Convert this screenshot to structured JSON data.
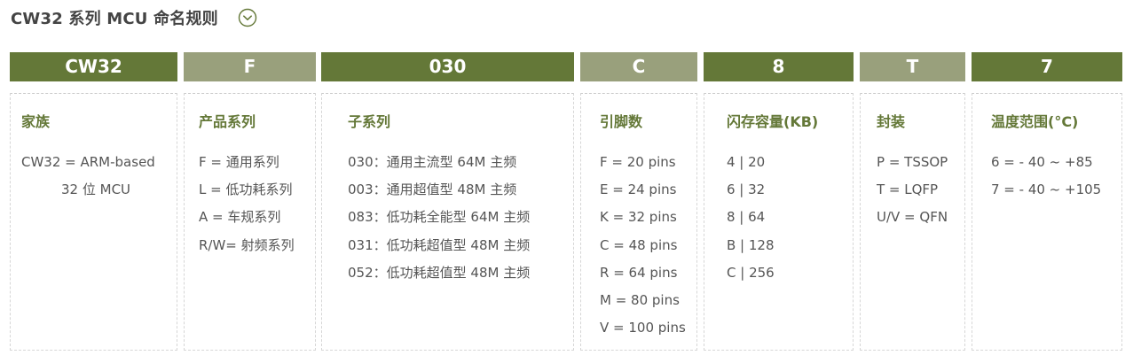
{
  "heading": {
    "title": "CW32 系列 MCU 命名规则",
    "toggle_icon": "chevron-down-circle-icon"
  },
  "colors": {
    "dark_bar": "#647838",
    "light_bar": "#99a07c",
    "label": "#647838"
  },
  "columns": [
    {
      "code": "CW32",
      "label": "家族",
      "items": [
        "CW32 = ARM-based",
        "32 位 MCU"
      ]
    },
    {
      "code": "F",
      "label": "产品系列",
      "items": [
        "F = 通用系列",
        "L = 低功耗系列",
        "A = 车规系列",
        "R/W= 射频系列"
      ]
    },
    {
      "code": "030",
      "label": "子系列",
      "items": [
        "030：通用主流型 64M 主频",
        "003：通用超值型 48M 主频",
        "083：低功耗全能型 64M 主频",
        "031：低功耗超值型 48M 主频",
        "052：低功耗超值型 48M 主频"
      ]
    },
    {
      "code": "C",
      "label": "引脚数",
      "items": [
        "F = 20 pins",
        "E = 24 pins",
        "K = 32 pins",
        "C = 48 pins",
        "R = 64 pins",
        "M = 80 pins",
        "V = 100 pins"
      ]
    },
    {
      "code": "8",
      "label": "闪存容量(KB)",
      "items": [
        "4 | 20",
        "6 | 32",
        "8 | 64",
        "B | 128",
        "C | 256"
      ]
    },
    {
      "code": "T",
      "label": "封装",
      "items": [
        "P = TSSOP",
        "T = LQFP",
        "U/V = QFN"
      ]
    },
    {
      "code": "7",
      "label": "温度范围(°C)",
      "items": [
        "6 = - 40 ~ +85",
        "7 = - 40 ~ +105"
      ]
    }
  ]
}
